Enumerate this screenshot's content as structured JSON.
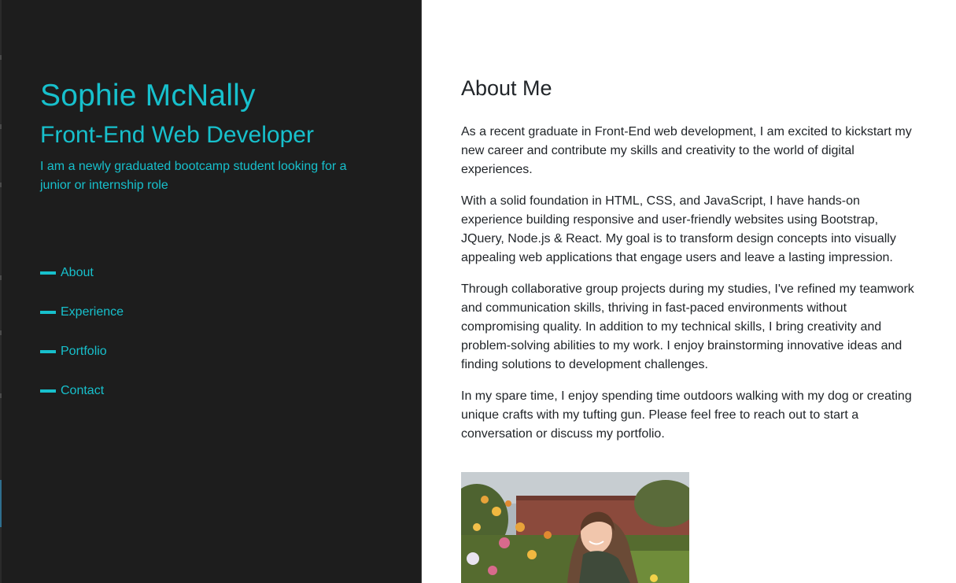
{
  "sidebar": {
    "name": "Sophie McNally",
    "role": "Front-End Web Developer",
    "tagline": "I am a newly graduated bootcamp student looking for a junior or internship role",
    "nav": [
      {
        "label": "About"
      },
      {
        "label": "Experience"
      },
      {
        "label": "Portfolio"
      },
      {
        "label": "Contact"
      }
    ]
  },
  "about": {
    "title": "About Me",
    "paragraphs": [
      "As a recent graduate in Front-End web development, I am excited to kickstart my new career and contribute my skills and creativity to the world of digital experiences.",
      "With a solid foundation in HTML, CSS, and JavaScript, I have hands-on experience building responsive and user-friendly websites using Bootstrap, JQuery, Node.js & React. My goal is to transform design concepts into visually appealing web applications that engage users and leave a lasting impression.",
      "Through collaborative group projects during my studies, I've refined my teamwork and communication skills, thriving in fast-paced environments without compromising quality. In addition to my technical skills, I bring creativity and problem-solving abilities to my work. I enjoy brainstorming innovative ideas and finding solutions to development challenges.",
      "In my spare time, I enjoy spending time outdoors walking with my dog or creating unique crafts with my tufting gun. Please feel free to reach out to start a conversation or discuss my portfolio."
    ]
  },
  "colors": {
    "accent": "#17c0cc",
    "sidebar_bg": "#1d1d1d",
    "text": "#212529"
  }
}
